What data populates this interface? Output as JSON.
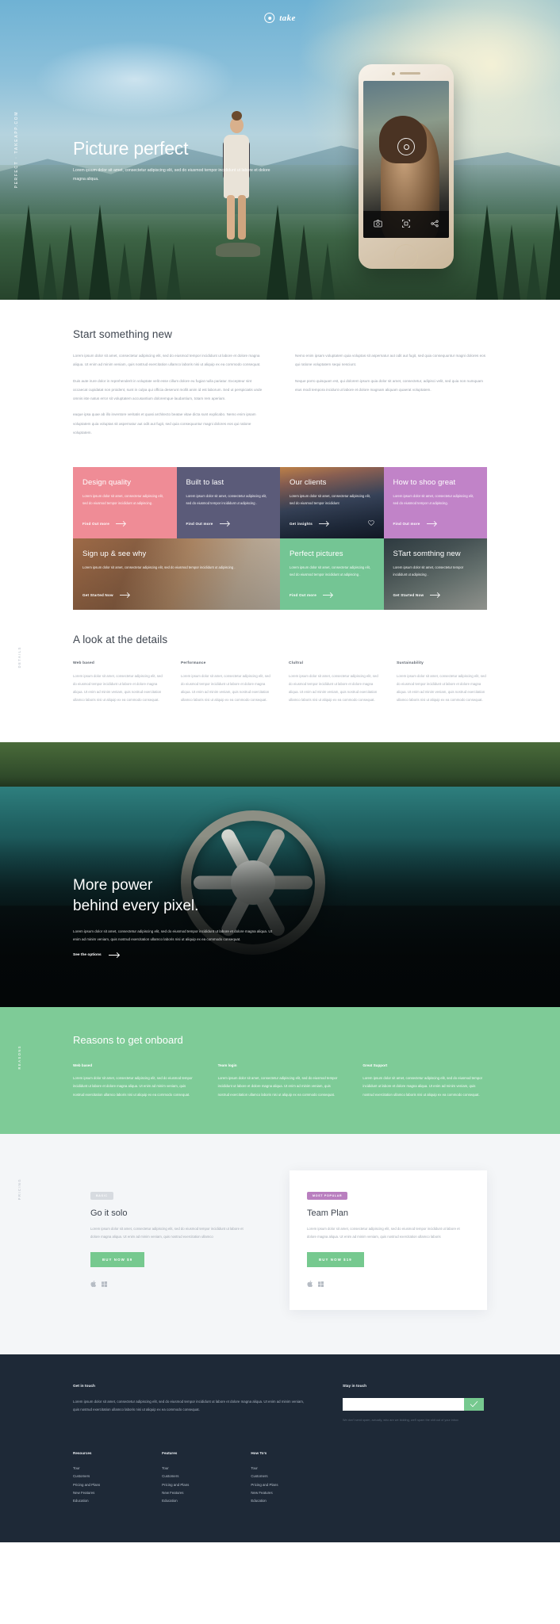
{
  "brand": {
    "name": "take",
    "logo_icon": "aperture-ring-icon"
  },
  "hero": {
    "side_rail": "PERFECT · TAKEAPP.COM",
    "title": "Picture perfect",
    "subtitle": "Lorem ipsum dolor sit amet, consectetur adipiscing elit, sed do eiusmod tempor incididunt ut labore et dolore magna aliqua.",
    "phone": {
      "shutter_icon": "aperture-ring-icon",
      "toolbar": [
        "camera-icon",
        "qr-scan-icon",
        "share-icon"
      ]
    }
  },
  "start": {
    "heading": "Start something new",
    "left_paragraphs": [
      "Lorem ipsum dolor sit amet, consectetur adipiscing elit, sed do eiusmod tempor incididunt ut labore et dolore magna aliqua. Ut enim ad minim veniam, quis nostrud exercitation ullamco laboris nisi ut aliquip ex ea commodo consequat.",
      "Duis aute irure dolor in reprehenderit in voluptate velit esse cillum dolore eu fugiat nulla pariatur. Excepteur sint occaecat cupidatat non proident, sunt in culpa qui officia deserunt mollit anim id est laborum. Sed ut perspiciatis unde omnis iste natus error sit voluptatem accusantium doloremque laudantium, totam rem aperiam.",
      "eaque ipsa quae ab illo inventore veritatis et quasi architecto beatae vitae dicta sunt explicabo. Nemo enim ipsam voluptatem quia voluptas sit aspernatur aut odit aut fugit, sed quia consequuntur magni dolores eos qui ratione voluptatem."
    ],
    "right_paragraphs": [
      "Nemo enim ipsam voluptatem quia voluptas sit aspernatur aut odit aut fugit, sed quia consequuntur magni dolores eos qui ratione voluptatem sequi nesciunt.",
      "Neque porro quisquam est, qui dolorem ipsum quia dolor sit amet, consectetur, adipisci velit, sed quia non numquam eius modi tempora incidunt ut labore et dolore magnam aliquam quaerat voluptatem."
    ]
  },
  "tiles": [
    {
      "title": "Design quality",
      "body": "Lorem ipsum dolor sit amet, consectetur adipiscing elit, sed do eiusmod tempor incididunt ut adipiscing .",
      "cta": "Find Out more",
      "style": "solid",
      "color": "#ef8c96",
      "span": 1,
      "heart": false
    },
    {
      "title": "Built to last",
      "body": "Lorem ipsum dolor sit amet, consectetur adipiscing elit, sed do eiusmod tempor incididunt ut adipiscing .",
      "cta": "Find Out more",
      "style": "solid",
      "color": "#5b5b79",
      "span": 1,
      "heart": false
    },
    {
      "title": "Our clients",
      "body": "Lorem ipsum dolor sit amet, consectetur adipiscing elit, sed do eiusmod tempor incididunt",
      "cta": "Get insights",
      "style": "image",
      "image": "img-clients",
      "span": 1,
      "heart": true
    },
    {
      "title": "How to shoo great",
      "body": "Lorem ipsum dolor sit amet, consectetur adipiscing elit, sed do eiusmod tempor ut adipiscing.",
      "cta": "Find Out more",
      "style": "solid",
      "color": "#c183c8",
      "span": 1,
      "heart": false
    },
    {
      "title": "Sign up & see why",
      "body": "Lorem ipsum dolor sit amet, consectetur adipiscing elit, sed do eiusmod tempor incididunt ut adipiscing .",
      "cta": "Get Started Now",
      "style": "image",
      "image": "img-signup",
      "span": 2,
      "heart": false
    },
    {
      "title": "Perfect pictures",
      "body": "Lorem ipsum dolor sit amet, consectetur adipiscing elit, sed do eiusmod tempor incididunt ut adipiscing .",
      "cta": "Find Out more",
      "style": "solid",
      "color": "#74c594",
      "span": 1,
      "heart": false
    },
    {
      "title": "STart somthing new",
      "body": "Lorem ipsum dolor sit amet, consectetur tempor incididunt ut adipiscing .",
      "cta": "Get Started Now",
      "style": "image",
      "image": "img-start2",
      "span": 1,
      "heart": false
    }
  ],
  "details": {
    "rail": "DETAILS",
    "heading": "A look at the details",
    "columns": [
      {
        "title": "Web based",
        "body": "Lorem ipsum dolor sit amet, consectetur adipiscing elit, sed do eiusmod tempor incididunt ut labore et dolore magna aliqua. Ut enim ad minim veniam, quis nostrud exercitation ullamco laboris nisi ut aliquip ex ea commodo consequat."
      },
      {
        "title": "Performance",
        "body": "Lorem ipsum dolor sit amet, consectetur adipiscing elit, sed do eiusmod tempor incididunt ut labore et dolore magna aliqua. Ut enim ad minim veniam, quis nostrud exercitation ullamco laboris nisi ut aliquip ex ea commodo consequat."
      },
      {
        "title": "Clultral",
        "body": "Lorem ipsum dolor sit amet, consectetur adipiscing elit, sed do eiusmod tempor incididunt ut labore et dolore magna aliqua. Ut enim ad minim veniam, quis nostrud exercitation ullamco laboris nisi ut aliquip ex ea commodo consequat."
      },
      {
        "title": "Sustainability",
        "body": "Lorem ipsum dolor sit amet, consectetur adipiscing elit, sed do eiusmod tempor incididunt ut labore et dolore magna aliqua. Ut enim ad minim veniam, quis nostrud exercitation ullamco laboris nisi ut aliquip ex ea commodo consequat."
      }
    ]
  },
  "power": {
    "title_line1": "More power",
    "title_line2": "behind every pixel.",
    "body": "Lorem ipsum dolor sit amet, consectetur adipiscing elit, sed do eiusmod tempor incididunt ut labore et dolore magna aliqua. Ut enim ad minim veniam, quis nostrud exercitation ullamco laboris nisi ut aliquip ex ea commodo consequat.",
    "cta": "See the options"
  },
  "reasons": {
    "rail": "REASONS",
    "heading": "Reasons to get onboard",
    "color": "#7ecb97",
    "columns": [
      {
        "title": "Web based",
        "body": "Lorem ipsum dolor sit amet, consectetur adipiscing elit, sed do eiusmod tempor incididunt ut labore et dolore magna aliqua. Ut enim ad minim veniam, quis nostrud exercitation ullamco laboris nisi ut aliquip ex ea commodo consequat."
      },
      {
        "title": "Team login",
        "body": "Lorem ipsum dolor sit amet, consectetur adipiscing elit, sed do eiusmod tempor incididunt ut labore et dolore magna aliqua. Ut enim ad minim veniam, quis nostrud exercitation ullamco laboris nisi ut aliquip ex ea commodo consequat."
      },
      {
        "title": "Great Support",
        "body": "Lorem ipsum dolor sit amet, consectetur adipiscing elit, sed do eiusmod tempor incididunt ut labore et dolore magna aliqua. Ut enim ad minim veniam, quis nostrud exercitation ullamco laboris nisi ut aliquip ex ea commodo consequat."
      }
    ]
  },
  "pricing": {
    "rail": "PRICING",
    "plans": [
      {
        "badge": "BASIC",
        "badge_color": "#d7dbe0",
        "name": "Go it solo",
        "body": "Lorem ipsum dolor sit amet, consectetur adipiscing elit, sed do eiusmod tempor incididunt ut labore et dolore magna aliqua. Ut enim ad minim veniam, quis nostrud exercitation ullamco",
        "buy_label": "BUY NOW $9",
        "stores": [
          "apple-icon",
          "windows-icon"
        ],
        "featured": false
      },
      {
        "badge": "MOST POPULAR",
        "badge_color": "#b97fbf",
        "name": "Team Plan",
        "body": "Lorem ipsum dolor sit amet, consectetur adipiscing elit, sed do eiusmod tempor incididunt ut labore et dolore magna aliqua. Ut enim ad minim veniam, quis nostrud exercitation ullamco laboris",
        "buy_label": "BUY NOW $19",
        "stores": [
          "apple-icon",
          "windows-icon"
        ],
        "featured": true
      }
    ]
  },
  "footer": {
    "get_in_touch_heading": "Get in touch",
    "get_in_touch_body": "Lorem ipsum dolor sit amet, consectetur adipiscing elit, sed do eiusmod tempor incididunt ut labore et dolore magna aliqua. Ut enim ad minim veniam, quis nostrud exercitation ullamco laboris nisi ut aliquip ex ea commodo consequat.",
    "stay_in_touch_heading": "Stay in touch",
    "email_placeholder": "",
    "email_value": "",
    "submit_icon": "check-icon",
    "note": "We don't send spam, actually, who are we kidding, we'll spam the shit out of your inbox",
    "columns": [
      {
        "title": "Resources",
        "links": [
          "Tour",
          "Customers",
          "Pricing and Plans",
          "New Features",
          "Education"
        ]
      },
      {
        "title": "Features",
        "links": [
          "Tour",
          "Customers",
          "Pricing and Plans",
          "New Features",
          "Education"
        ]
      },
      {
        "title": "How To's",
        "links": [
          "Tour",
          "Customers",
          "Pricing and Plans",
          "New Features",
          "Education"
        ]
      }
    ]
  }
}
